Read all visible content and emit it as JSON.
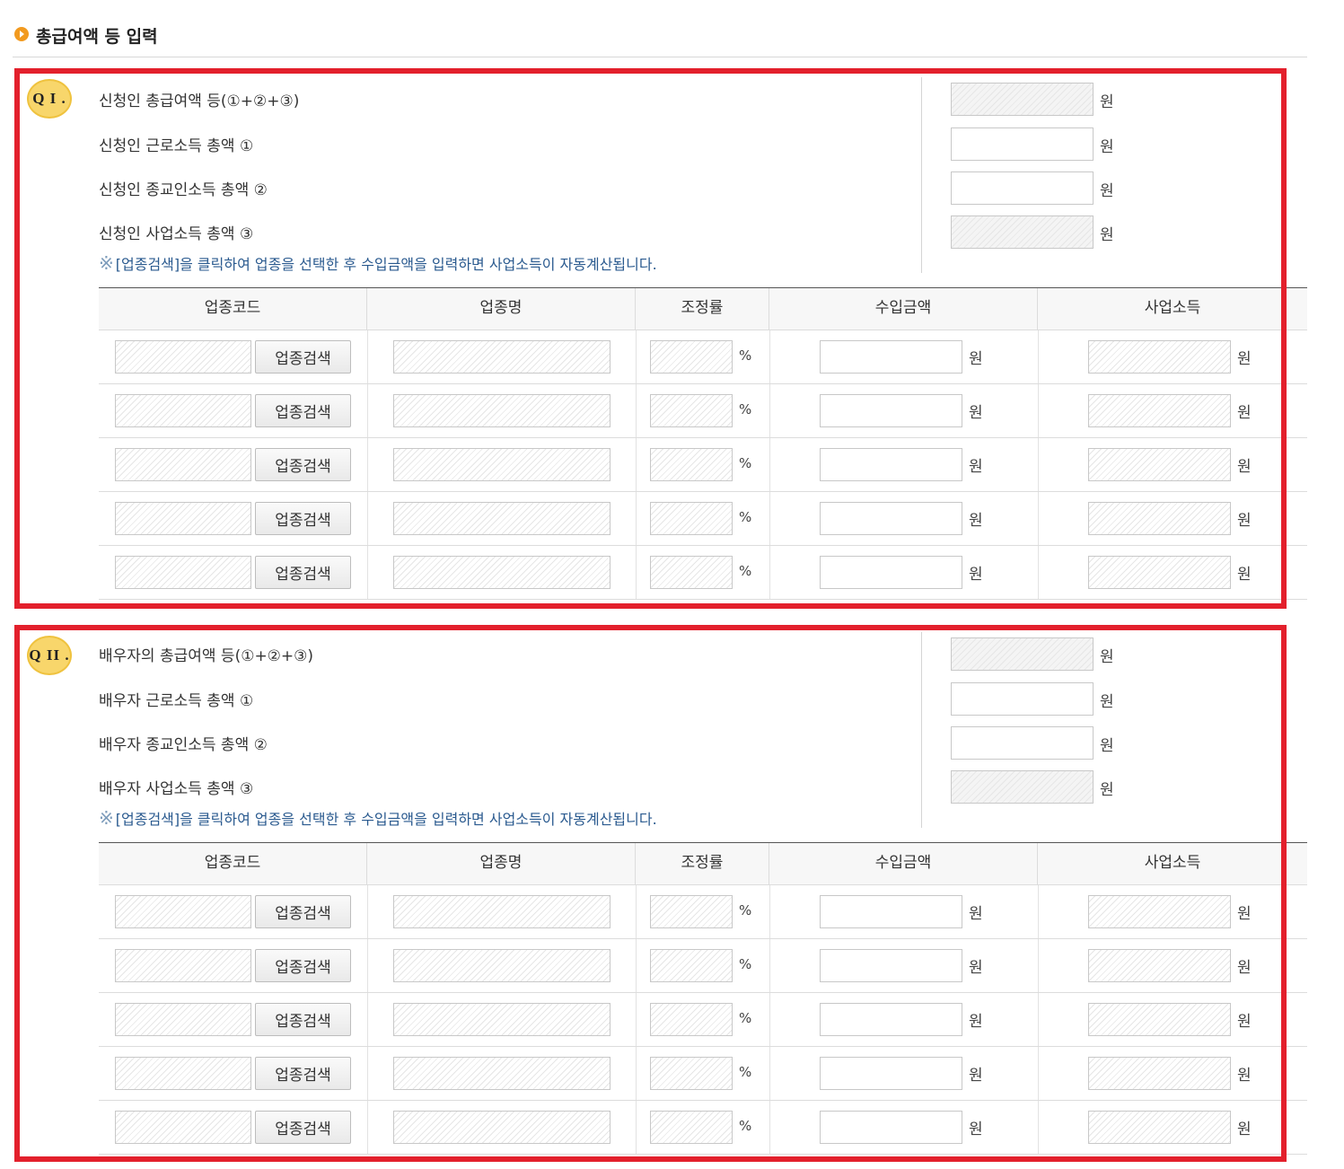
{
  "page": {
    "title": "총급여액 등 입력"
  },
  "currency_unit": "원",
  "percent_unit": "%",
  "notice_mark": "※",
  "table_headers": [
    "업종코드",
    "업종명",
    "조정률",
    "수입금액",
    "사업소득"
  ],
  "search_button_label": "업종검색",
  "sections": [
    {
      "badge": "Q I .",
      "summary": [
        {
          "label": "신청인 총급여액 등(①+②+③)",
          "value": "",
          "readonly": true
        },
        {
          "label": "신청인 근로소득 총액 ①",
          "value": "",
          "readonly": false
        },
        {
          "label": "신청인 종교인소득 총액 ②",
          "value": "",
          "readonly": false
        },
        {
          "label": "신청인 사업소득 총액 ③",
          "value": "",
          "readonly": true
        }
      ],
      "notice": "[업종검색]을 클릭하여 업종을 선택한 후 수입금액을 입력하면 사업소득이 자동계산됩니다.",
      "rows": [
        {
          "code": "",
          "name": "",
          "rate": "",
          "revenue": "",
          "income": ""
        },
        {
          "code": "",
          "name": "",
          "rate": "",
          "revenue": "",
          "income": ""
        },
        {
          "code": "",
          "name": "",
          "rate": "",
          "revenue": "",
          "income": ""
        },
        {
          "code": "",
          "name": "",
          "rate": "",
          "revenue": "",
          "income": ""
        },
        {
          "code": "",
          "name": "",
          "rate": "",
          "revenue": "",
          "income": ""
        }
      ]
    },
    {
      "badge": "Q II .",
      "summary": [
        {
          "label": "배우자의 총급여액 등(①+②+③)",
          "value": "",
          "readonly": true
        },
        {
          "label": "배우자 근로소득 총액 ①",
          "value": "",
          "readonly": false
        },
        {
          "label": "배우자 종교인소득 총액 ②",
          "value": "",
          "readonly": false
        },
        {
          "label": "배우자 사업소득 총액 ③",
          "value": "",
          "readonly": true
        }
      ],
      "notice": "[업종검색]을 클릭하여 업종을 선택한 후 수입금액을 입력하면 사업소득이 자동계산됩니다.",
      "rows": [
        {
          "code": "",
          "name": "",
          "rate": "",
          "revenue": "",
          "income": ""
        },
        {
          "code": "",
          "name": "",
          "rate": "",
          "revenue": "",
          "income": ""
        },
        {
          "code": "",
          "name": "",
          "rate": "",
          "revenue": "",
          "income": ""
        },
        {
          "code": "",
          "name": "",
          "rate": "",
          "revenue": "",
          "income": ""
        },
        {
          "code": "",
          "name": "",
          "rate": "",
          "revenue": "",
          "income": ""
        }
      ]
    }
  ]
}
